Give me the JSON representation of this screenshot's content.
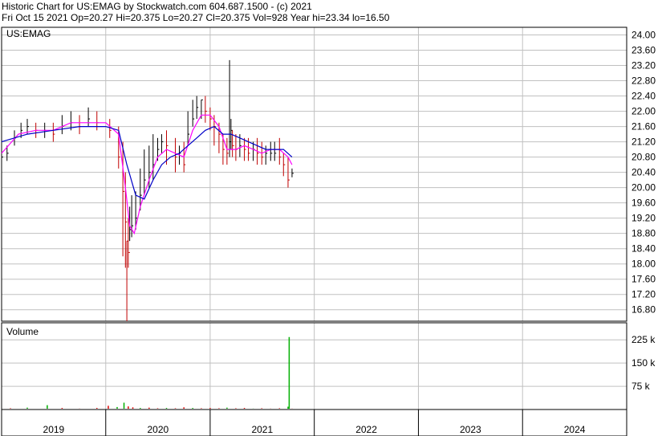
{
  "header": {
    "line1": "Historic Chart for US:EMAG by Stockwatch.com 604.687.1500 - (c) 2021",
    "line2": "Fri Oct 15 2021   Op=20.27   Hi=20.375   Lo=20.27   Cl=20.375   Vol=928   Year hi=23.34   lo=16.50"
  },
  "colors": {
    "background": "#ffffff",
    "grid": "#c0c0c0",
    "ma_short": "#ff00ff",
    "ma_long": "#0000c8",
    "vol_up": "#00b000",
    "vol_down": "#e00000",
    "price_up": "#000000",
    "price_down": "#c00000"
  },
  "chart_data": [
    {
      "type": "line",
      "title": "US:EMAG",
      "ylim": [
        16.5,
        24.2
      ],
      "yticks": [
        "24.00",
        "23.60",
        "23.20",
        "22.80",
        "22.40",
        "22.00",
        "21.60",
        "21.20",
        "20.80",
        "20.40",
        "20.00",
        "19.60",
        "19.20",
        "18.80",
        "18.40",
        "18.00",
        "17.60",
        "17.20",
        "16.80"
      ],
      "x_axis": {
        "labels": [
          "2019",
          "2020",
          "2021",
          "2022",
          "2023",
          "2024"
        ],
        "start": "2019-01-01",
        "end": "2024-12-31"
      },
      "series": [
        {
          "kind": "price",
          "x": [
            "2019-01-01",
            "2019-01-20",
            "2019-02-15",
            "2019-03-10",
            "2019-04-01",
            "2019-05-01",
            "2019-06-01",
            "2019-07-01",
            "2019-08-01",
            "2019-09-01",
            "2019-10-01",
            "2019-11-01",
            "2019-12-01",
            "2020-01-15",
            "2020-02-15",
            "2020-03-01",
            "2020-03-10",
            "2020-03-15",
            "2020-03-20",
            "2020-03-25",
            "2020-04-01",
            "2020-04-15",
            "2020-05-01",
            "2020-05-15",
            "2020-06-01",
            "2020-06-15",
            "2020-07-01",
            "2020-07-15",
            "2020-08-01",
            "2020-09-01",
            "2020-09-15",
            "2020-10-01",
            "2020-10-15",
            "2020-11-01",
            "2020-11-15",
            "2020-12-01",
            "2020-12-15",
            "2021-01-01",
            "2021-01-15",
            "2021-02-01",
            "2021-02-15",
            "2021-03-01",
            "2021-03-10",
            "2021-03-15",
            "2021-03-20",
            "2021-04-01",
            "2021-04-15",
            "2021-05-01",
            "2021-05-15",
            "2021-06-01",
            "2021-06-15",
            "2021-07-01",
            "2021-07-15",
            "2021-08-01",
            "2021-08-15",
            "2021-09-01",
            "2021-09-15",
            "2021-10-01",
            "2021-10-15"
          ],
          "values": [
            20.8,
            20.9,
            21.3,
            21.5,
            21.6,
            21.5,
            21.5,
            21.4,
            21.6,
            21.7,
            21.6,
            21.8,
            21.7,
            21.5,
            20.8,
            19.9,
            19.1,
            18.6,
            18.3,
            18.9,
            19.0,
            19.2,
            19.8,
            20.2,
            20.4,
            20.6,
            21.0,
            21.2,
            21.1,
            20.8,
            20.9,
            20.6,
            21.4,
            21.8,
            22.1,
            22.3,
            22.0,
            21.8,
            21.6,
            21.4,
            21.0,
            20.9,
            21.2,
            21.5,
            21.1,
            21.0,
            21.1,
            21.0,
            20.9,
            21.0,
            20.9,
            20.8,
            20.9,
            20.9,
            20.9,
            20.8,
            20.6,
            20.2,
            20.375
          ],
          "highs": [
            21.0,
            21.1,
            21.5,
            21.7,
            21.8,
            21.7,
            21.7,
            21.7,
            21.9,
            22.0,
            21.9,
            22.1,
            22.0,
            21.8,
            21.6,
            21.2,
            20.4,
            18.6,
            19.2,
            19.5,
            19.8,
            19.9,
            20.5,
            21.0,
            21.1,
            21.4,
            21.3,
            21.4,
            21.5,
            21.3,
            21.1,
            21.2,
            22.0,
            22.3,
            22.4,
            22.3,
            22.4,
            22.1,
            21.9,
            21.7,
            21.4,
            21.3,
            23.34,
            21.8,
            21.5,
            21.4,
            21.4,
            21.3,
            21.3,
            21.2,
            21.3,
            21.2,
            21.1,
            21.2,
            21.2,
            21.3,
            20.9,
            20.8,
            20.5
          ],
          "lows": [
            20.6,
            20.7,
            21.1,
            21.3,
            21.4,
            21.3,
            21.3,
            21.2,
            21.4,
            21.5,
            21.4,
            21.6,
            21.5,
            21.3,
            20.5,
            18.2,
            17.9,
            16.5,
            17.9,
            18.6,
            18.7,
            18.9,
            19.4,
            19.8,
            20.0,
            20.2,
            20.7,
            20.9,
            20.6,
            20.4,
            20.6,
            20.4,
            21.1,
            21.6,
            21.8,
            21.8,
            21.7,
            21.5,
            21.1,
            20.9,
            20.6,
            20.6,
            20.8,
            21.0,
            20.8,
            20.7,
            20.8,
            20.7,
            20.7,
            20.7,
            20.6,
            20.6,
            20.6,
            20.7,
            20.7,
            20.6,
            20.3,
            20.0,
            20.27
          ]
        },
        {
          "kind": "ma_short",
          "x": [
            "2019-01-01",
            "2019-03-01",
            "2019-05-01",
            "2019-07-01",
            "2019-09-01",
            "2019-11-01",
            "2020-01-01",
            "2020-02-15",
            "2020-03-10",
            "2020-03-25",
            "2020-04-10",
            "2020-05-01",
            "2020-06-01",
            "2020-07-01",
            "2020-08-01",
            "2020-09-01",
            "2020-10-01",
            "2020-11-01",
            "2020-12-01",
            "2021-01-01",
            "2021-02-01",
            "2021-03-01",
            "2021-04-01",
            "2021-05-01",
            "2021-06-01",
            "2021-07-01",
            "2021-08-01",
            "2021-09-01",
            "2021-10-01",
            "2021-10-15"
          ],
          "values": [
            20.9,
            21.4,
            21.5,
            21.5,
            21.7,
            21.7,
            21.7,
            21.4,
            20.0,
            19.0,
            18.8,
            19.5,
            20.2,
            20.8,
            21.0,
            20.9,
            20.8,
            21.5,
            21.9,
            21.9,
            21.6,
            21.0,
            21.0,
            21.1,
            21.0,
            20.9,
            21.0,
            21.0,
            20.8,
            20.6
          ]
        },
        {
          "kind": "ma_long",
          "x": [
            "2019-01-01",
            "2019-04-01",
            "2019-07-01",
            "2019-10-01",
            "2020-01-01",
            "2020-02-15",
            "2020-03-15",
            "2020-04-15",
            "2020-05-15",
            "2020-06-15",
            "2020-07-15",
            "2020-08-15",
            "2020-09-15",
            "2020-10-15",
            "2020-11-15",
            "2020-12-15",
            "2021-01-15",
            "2021-02-15",
            "2021-03-15",
            "2021-04-15",
            "2021-05-15",
            "2021-06-15",
            "2021-07-15",
            "2021-08-15",
            "2021-09-15",
            "2021-10-15"
          ],
          "values": [
            21.2,
            21.4,
            21.5,
            21.6,
            21.6,
            21.5,
            20.6,
            19.8,
            19.7,
            20.2,
            20.6,
            20.8,
            20.9,
            21.1,
            21.3,
            21.5,
            21.6,
            21.4,
            21.4,
            21.3,
            21.2,
            21.1,
            21.0,
            21.0,
            21.0,
            20.8
          ]
        }
      ]
    },
    {
      "type": "bar",
      "title": "Volume",
      "ylim": [
        0,
        280
      ],
      "yticks": [
        "225 k",
        "150 k",
        "75 k"
      ],
      "x": [
        "2019-02-01",
        "2019-04-01",
        "2019-06-10",
        "2019-08-01",
        "2019-10-01",
        "2019-12-01",
        "2020-01-10",
        "2020-02-10",
        "2020-03-05",
        "2020-03-20",
        "2020-04-05",
        "2020-05-01",
        "2020-06-01",
        "2020-07-01",
        "2020-08-01",
        "2020-09-01",
        "2020-10-01",
        "2020-11-01",
        "2020-12-01",
        "2021-01-01",
        "2021-02-01",
        "2021-03-01",
        "2021-04-01",
        "2021-05-01",
        "2021-06-01",
        "2021-07-01",
        "2021-08-01",
        "2021-09-01",
        "2021-10-01",
        "2021-10-05",
        "2021-10-15"
      ],
      "values": [
        4,
        6,
        14,
        5,
        3,
        5,
        12,
        8,
        22,
        10,
        7,
        5,
        6,
        4,
        5,
        4,
        7,
        5,
        4,
        5,
        4,
        6,
        4,
        5,
        3,
        4,
        3,
        4,
        9,
        234,
        3
      ],
      "up": [
        false,
        true,
        true,
        false,
        false,
        false,
        false,
        true,
        true,
        false,
        false,
        true,
        false,
        false,
        true,
        false,
        false,
        true,
        false,
        false,
        false,
        true,
        false,
        false,
        true,
        false,
        false,
        false,
        true,
        true,
        false
      ]
    }
  ]
}
